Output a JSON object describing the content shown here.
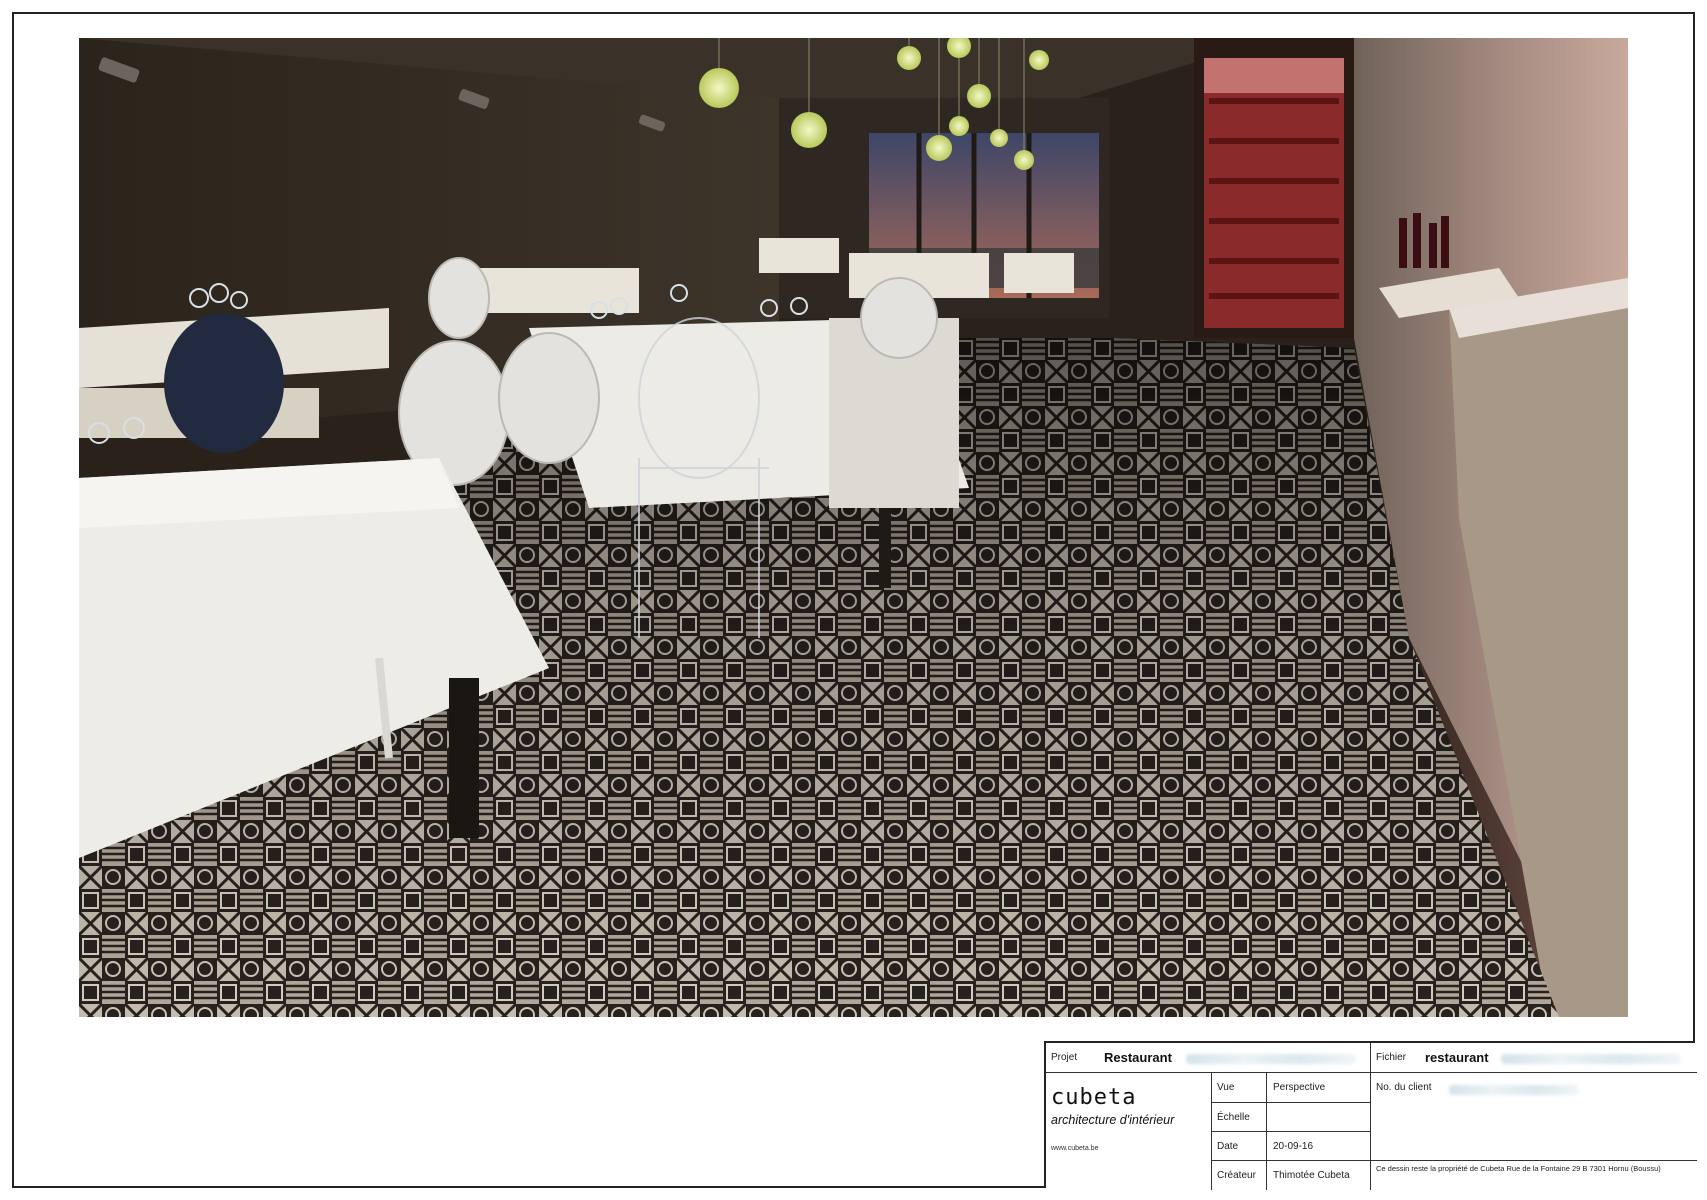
{
  "title_block": {
    "project_label": "Projet",
    "project_value": "Restaurant",
    "file_label": "Fichier",
    "file_value": "restaurant",
    "logo_name": "cubeta",
    "logo_tagline": "architecture d'intérieur",
    "logo_url": "www.cubeta.be",
    "view_label": "Vue",
    "view_value": "Perspective",
    "scale_label": "Échelle",
    "scale_value": "",
    "date_label": "Date",
    "date_value": "20-09-16",
    "creator_label": "Créateur",
    "creator_value": "Thimotée Cubeta",
    "client_label": "No. du client",
    "note": "Ce dessin reste la propriété de Cubeta  Rue de la Fontaine 29 B 7301 Hornu (Boussu)"
  },
  "render": {
    "subject": "restaurant-interior-perspective",
    "colors": {
      "wall": "#2d261d",
      "floor_dark": "#2a2420",
      "floor_light": "#d8cfc3",
      "tablecloth": "#e8e4da",
      "lamp": "#d8e47a",
      "wine_rack": "#8a2a2a",
      "concrete": "#9b8d82"
    }
  }
}
